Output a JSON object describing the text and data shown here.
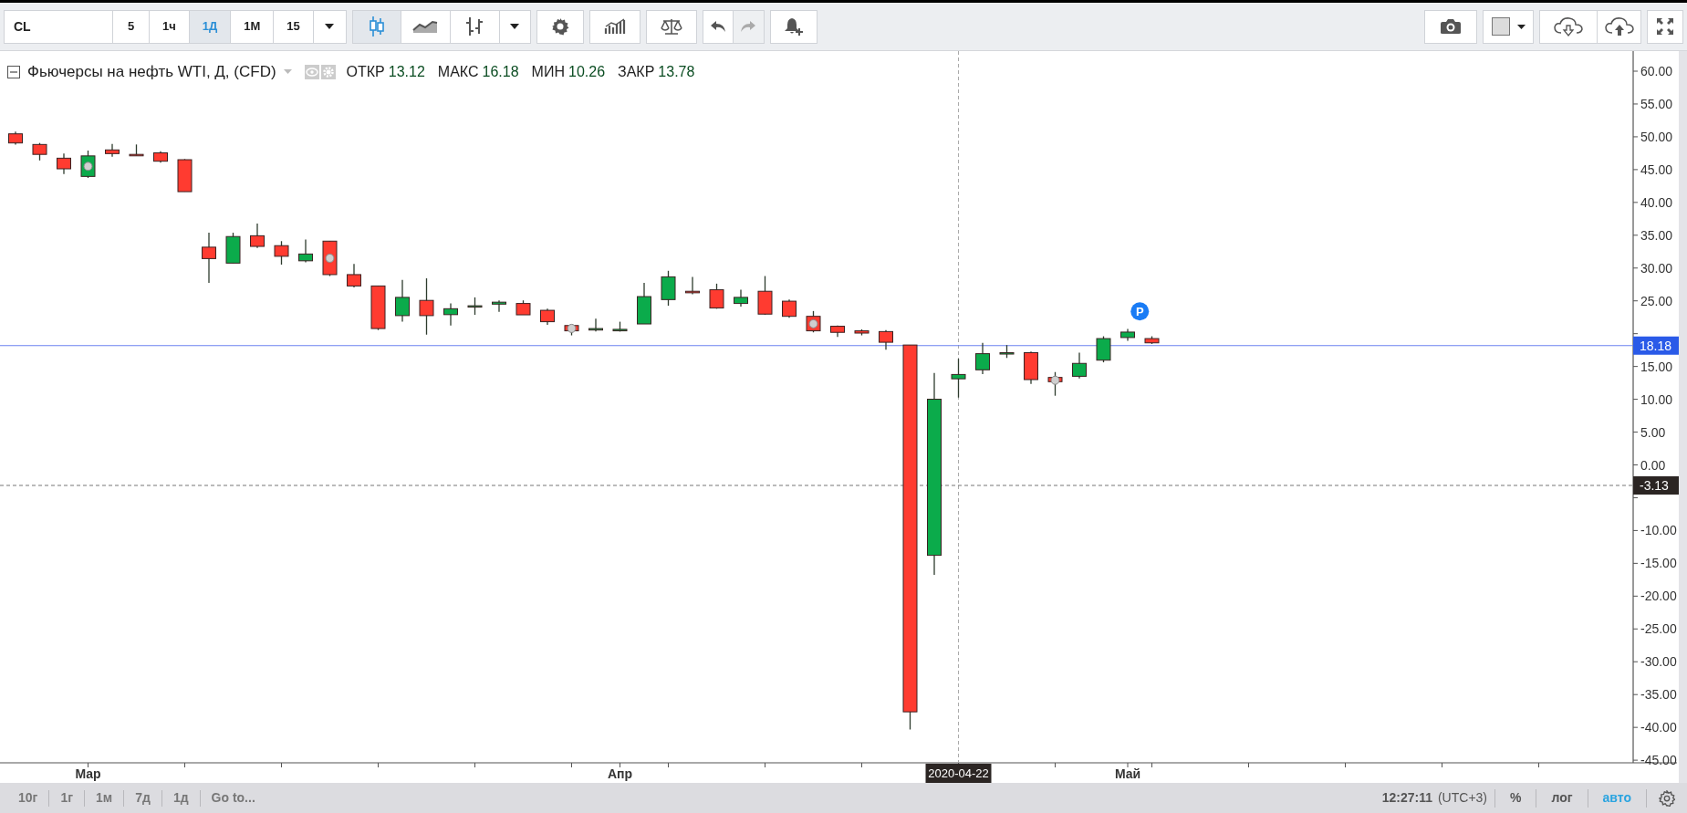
{
  "toolbar": {
    "symbol": "CL",
    "intervals": [
      {
        "label": "5",
        "selected": false
      },
      {
        "label": "1ч",
        "selected": false
      },
      {
        "label": "1Д",
        "selected": true
      },
      {
        "label": "1М",
        "selected": false
      },
      {
        "label": "15",
        "selected": false
      }
    ],
    "chart_types": [
      {
        "kind": "candles",
        "selected": true
      },
      {
        "kind": "line",
        "selected": false
      },
      {
        "kind": "bars",
        "selected": false
      }
    ],
    "redo_enabled": false
  },
  "legend": {
    "title": "Фьючерсы на нефть WTI, Д, (CFD)",
    "values": [
      {
        "label": "ОТКР",
        "value": "13.12"
      },
      {
        "label": "МАКС",
        "value": "16.18"
      },
      {
        "label": "МИН",
        "value": "10.26"
      },
      {
        "label": "ЗАКР",
        "value": "13.78"
      }
    ]
  },
  "chart": {
    "price_axis": [
      "60.00",
      "55.00",
      "50.00",
      "45.00",
      "40.00",
      "35.00",
      "30.00",
      "25.00",
      "15.00",
      "10.00",
      "5.00",
      "0.00",
      "-10.00",
      "-15.00",
      "-20.00",
      "-25.00",
      "-30.00",
      "-35.00",
      "-40.00",
      "-45.00"
    ],
    "time_axis": [
      "Мар",
      "Апр",
      "Май"
    ],
    "event_badge": "P",
    "last_price": "18.18",
    "crosshair": {
      "price": "-3.13",
      "date": "2020-04-22"
    }
  },
  "bottom_bar": {
    "ranges": [
      "10г",
      "1г",
      "1м",
      "7д",
      "1д"
    ],
    "goto": "Go to...",
    "time": "12:27:11",
    "timezone": "(UTC+3)",
    "scale_modes": [
      {
        "label": "%",
        "selected": false
      },
      {
        "label": "лог",
        "selected": false
      },
      {
        "label": "авто",
        "selected": true
      }
    ]
  }
}
